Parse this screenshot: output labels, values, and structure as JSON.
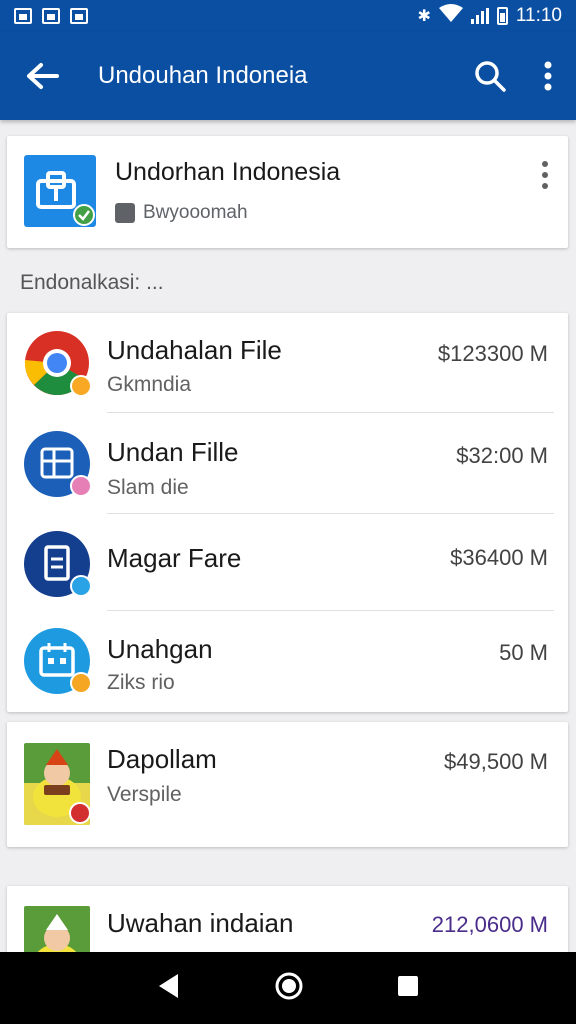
{
  "status_bar": {
    "time": "11:10"
  },
  "app_bar": {
    "title": "Undouhan Indoneia"
  },
  "header_card": {
    "title": "Undorhan Indonesia",
    "subtitle": "Bwyooomah"
  },
  "section": {
    "label": "Endonalkasi: ..."
  },
  "downloads": [
    {
      "name": "Undahalan File",
      "sub": "Gkmndia",
      "size": "$123300 M",
      "icon": "chrome-icon",
      "badge_color": "#f9a825"
    },
    {
      "name": "Undan Fille",
      "sub": "Slam die",
      "size": "$32:00 M",
      "icon": "blue-grid-icon",
      "badge_color": "#e57fb5"
    },
    {
      "name": "Magar Fare",
      "sub": "",
      "size": "$36400 M",
      "icon": "file-icon",
      "badge_color": "#29a3e6"
    },
    {
      "name": "Unahgan",
      "sub": "Ziks rio",
      "size": "50 M",
      "icon": "calendar-icon",
      "badge_color": "#f5a623"
    }
  ],
  "card2": {
    "name": "Dapollam",
    "sub": "Verspile",
    "size": "$49,500 M"
  },
  "card3": {
    "name": "Uwahan indaian",
    "size": "212,0600 M",
    "size_color": "#4a2c8a"
  },
  "colors": {
    "primary": "#0b4fa3",
    "background": "#efeff1"
  }
}
